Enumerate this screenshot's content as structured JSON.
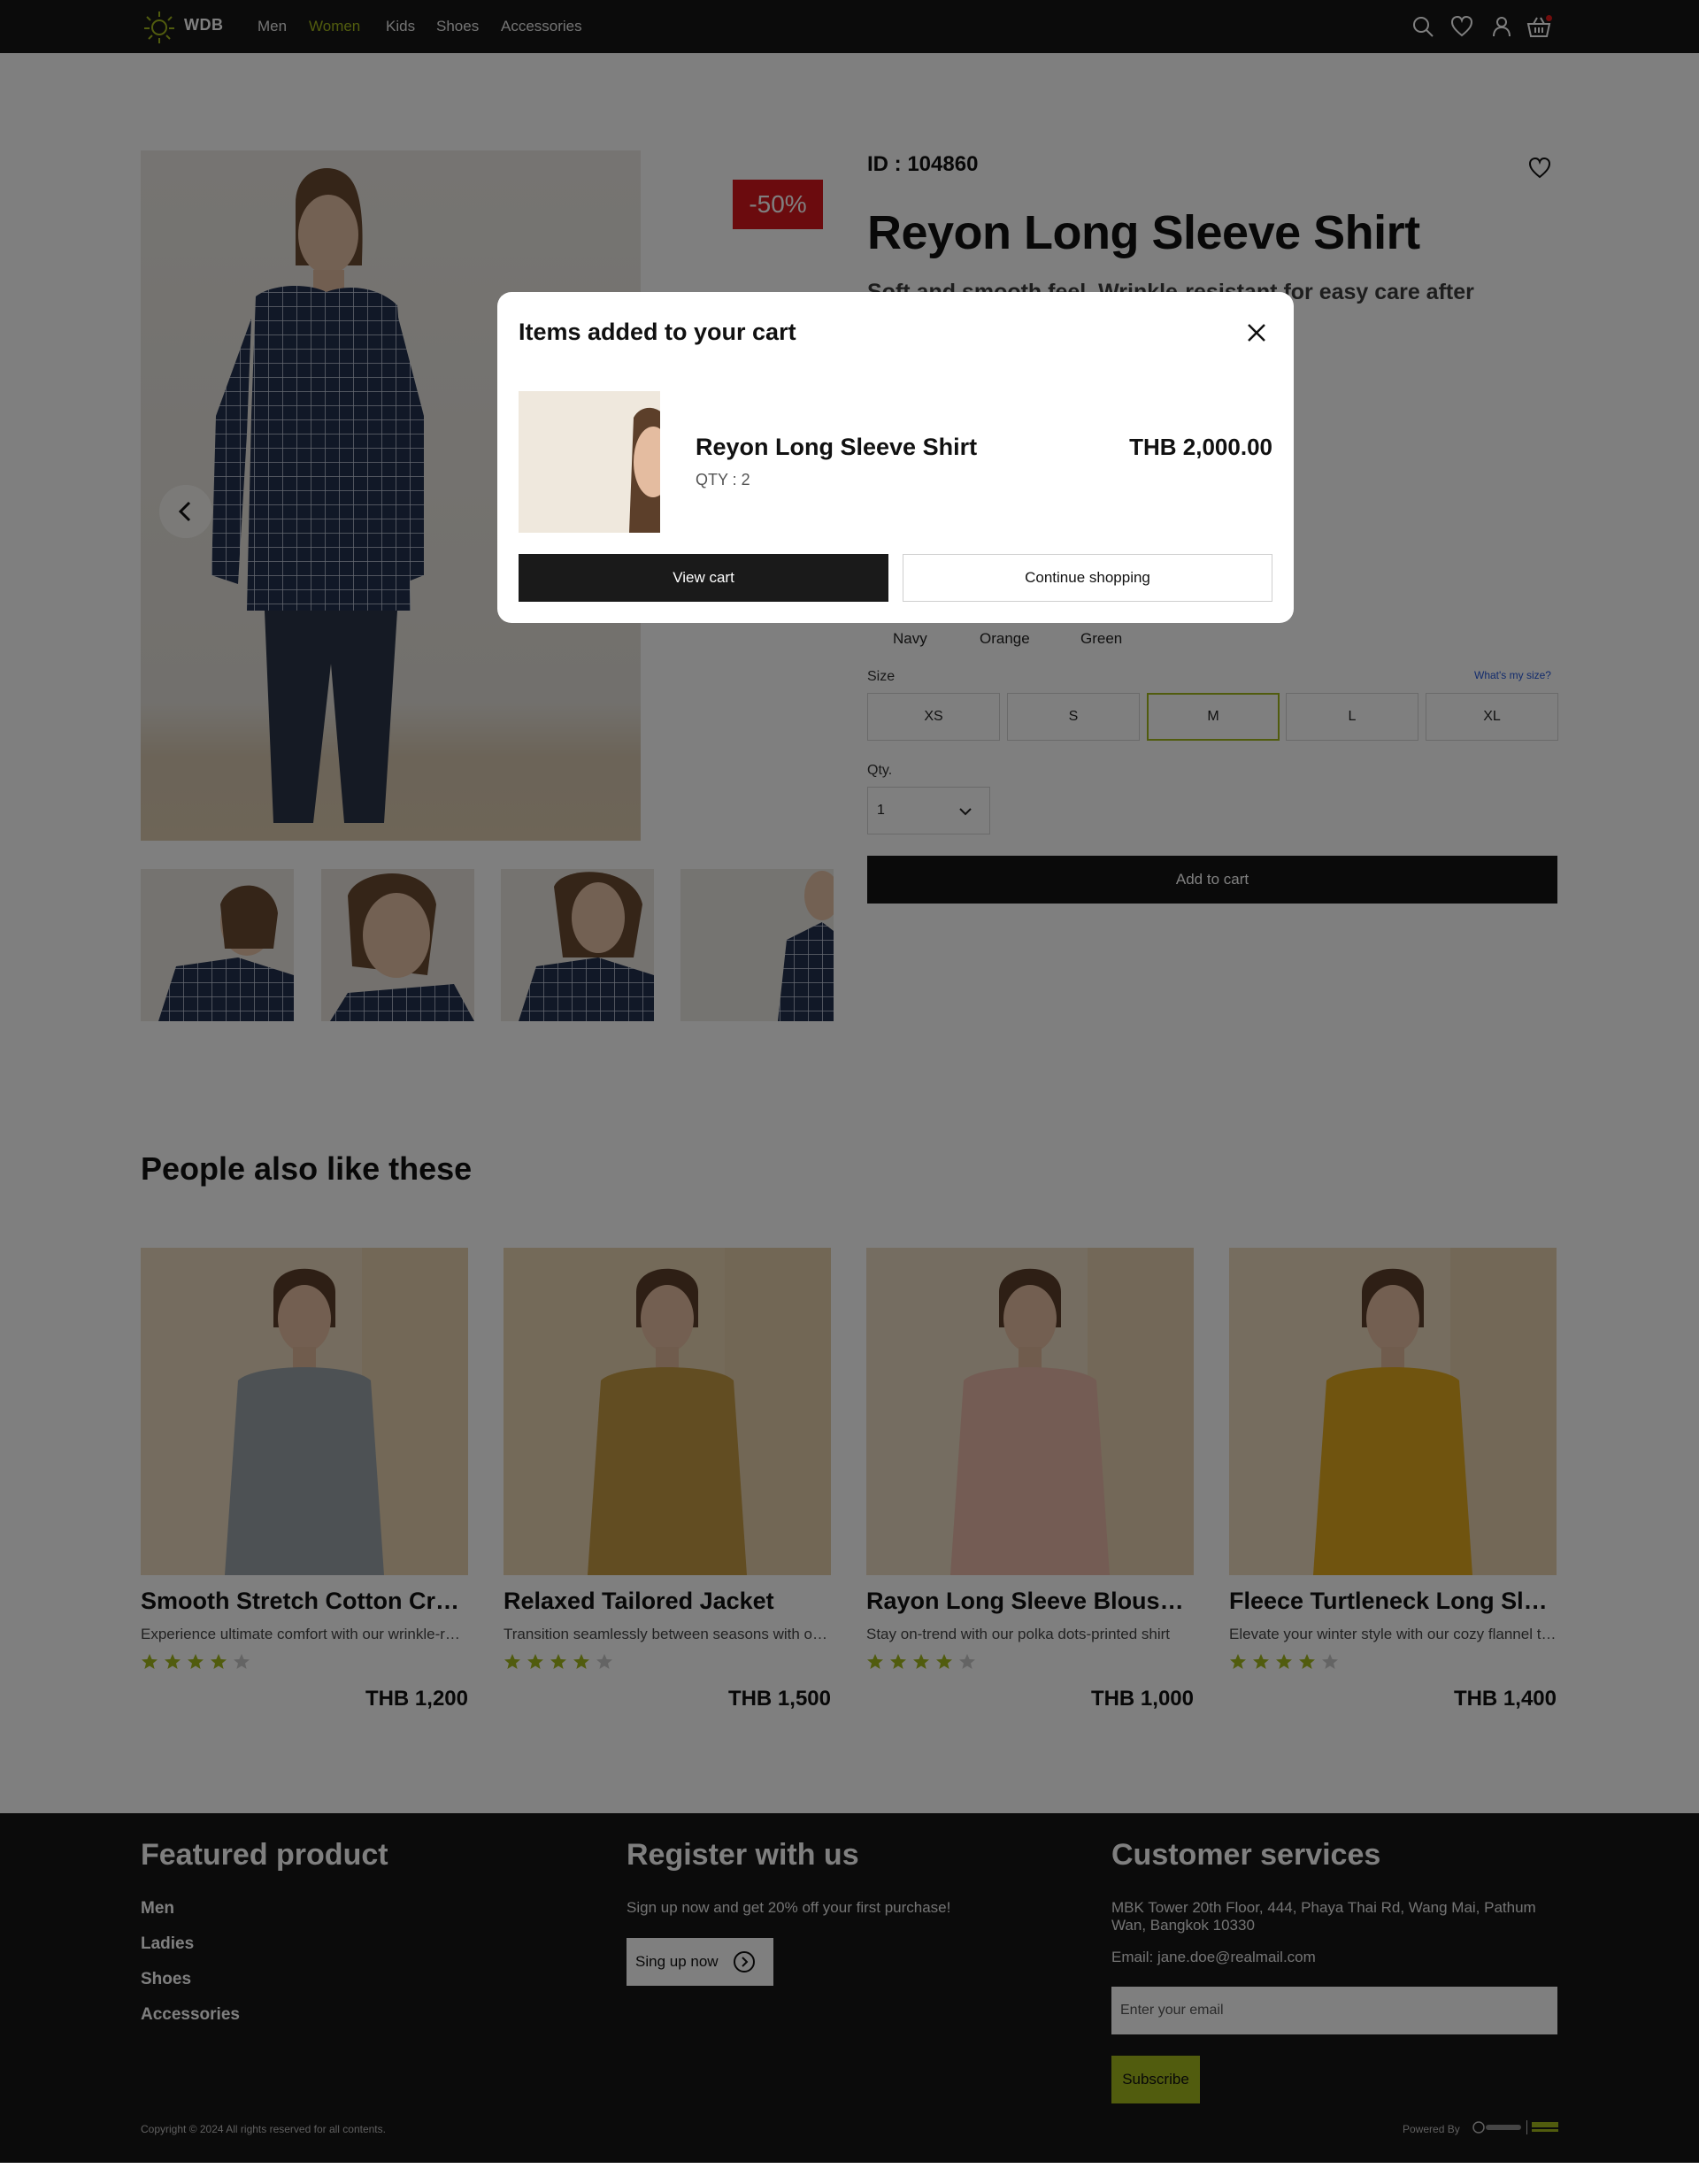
{
  "nav": {
    "brand": "WDB",
    "links": [
      "Men",
      "Women",
      "Kids",
      "Shoes",
      "Accessories"
    ],
    "active_link": "Women",
    "accent_color": "#a2b81c"
  },
  "product": {
    "id_text": "ID : 104860",
    "title": "Reyon Long Sleeve Shirt",
    "subtitle": "Soft and smooth feel. Wrinkle-resistant for easy care after",
    "discount": "-50%",
    "colors": [
      "Navy",
      "Orange",
      "Green"
    ],
    "size_label": "Size",
    "size_guide": "What's my size?",
    "sizes": [
      "XS",
      "S",
      "M",
      "L",
      "XL"
    ],
    "selected_size": "M",
    "qty_label": "Qty.",
    "qty_value": "1",
    "add_to_cart": "Add to cart"
  },
  "recommendations": {
    "title": "People also like these",
    "items": [
      {
        "title": "Smooth Stretch Cotton Crew Neck Long Sleeve T-Shirt",
        "desc": "Experience ultimate comfort with our wrinkle-resistant cotton",
        "rating": 4,
        "price": "THB 1,200",
        "shirt_color": "#9aa3a8"
      },
      {
        "title": "Relaxed Tailored Jacket",
        "desc": "Transition seamlessly between seasons with our relaxed jacket",
        "rating": 4,
        "price": "THB 1,500",
        "shirt_color": "#c49a45"
      },
      {
        "title": "Rayon Long Sleeve Blouse (Polka Dots)",
        "desc": "Stay on-trend with our polka dots-printed shirt",
        "rating": 4,
        "price": "THB 1,000",
        "shirt_color": "#e8b9a8"
      },
      {
        "title": "Fleece Turtleneck Long Sleeve T-Shirt",
        "desc": "Elevate your winter style with our cozy flannel turtleneck",
        "rating": 4,
        "price": "THB 1,400",
        "shirt_color": "#e0a91f"
      }
    ],
    "star_on_color": "#a2b81c",
    "star_off_color": "#c9c9c9"
  },
  "footer": {
    "featured_heading": "Featured product",
    "featured_links": [
      "Men",
      "Ladies",
      "Shoes",
      "Accessories"
    ],
    "register_heading": "Register with us",
    "register_text": "Sign up now and get 20% off your first purchase!",
    "signup_button": "Sing up now",
    "services_heading": "Customer services",
    "address": "MBK Tower 20th Floor, 444, Phaya Thai Rd, Wang Mai, Pathum Wan, Bangkok 10330",
    "email": "Email: jane.doe@realmail.com",
    "email_placeholder": "Enter your email",
    "subscribe_button": "Subscribe",
    "copyright": "Copyright © 2024 All rights reserved for all contents.",
    "powered_by": "Powered By"
  },
  "modal": {
    "title": "Items added to your cart",
    "item_name": "Reyon Long Sleeve Shirt",
    "item_qty": "QTY : 2",
    "item_price": "THB 2,000.00",
    "view_cart": "View cart",
    "continue_shopping": "Continue shopping"
  }
}
